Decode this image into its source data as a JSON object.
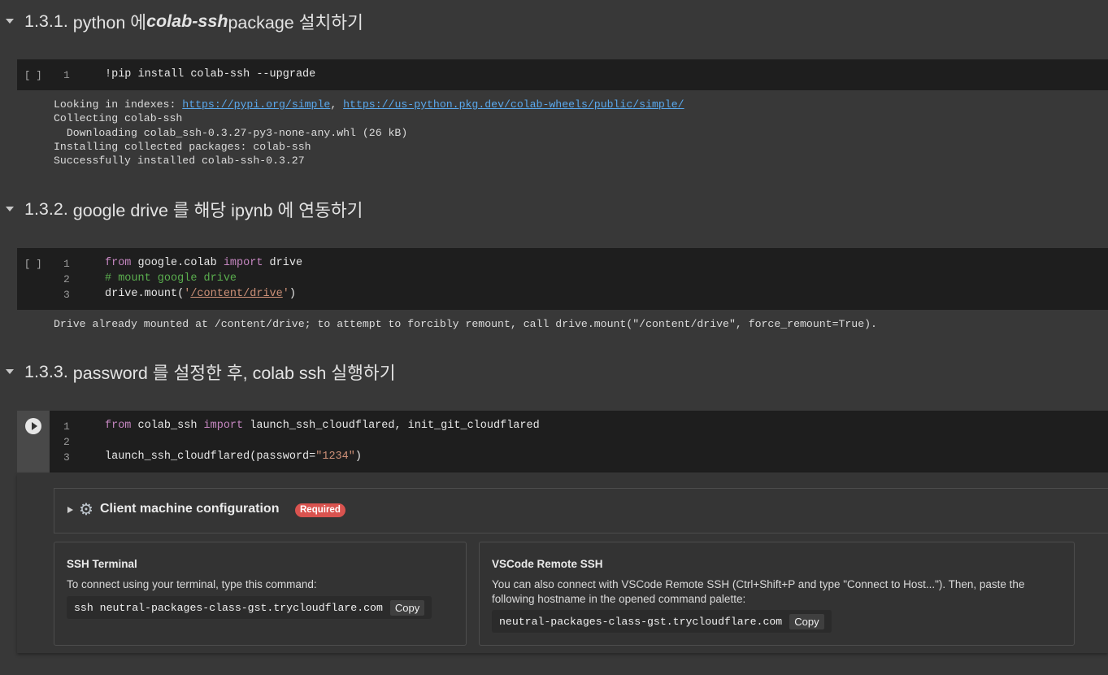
{
  "sections": [
    {
      "number": "1.3.1.",
      "pre": "python 에 ",
      "em": "colab-ssh",
      "post": " package 설치하기"
    },
    {
      "number": "1.3.2.",
      "pre": "google drive 를 해당 ipynb 에 연동하기",
      "em": "",
      "post": ""
    },
    {
      "number": "1.3.3.",
      "pre": "password 를 설정한 후, colab ssh 실행하기",
      "em": "",
      "post": ""
    }
  ],
  "cell1": {
    "exec": "[ ]",
    "line1_num": "1",
    "line1": "!pip install colab-ssh --upgrade",
    "output": {
      "l1_prefix": "Looking in indexes: ",
      "link1": "https://pypi.org/simple",
      "sep": ", ",
      "link2": "https://us-python.pkg.dev/colab-wheels/public/simple/",
      "l2": "Collecting colab-ssh",
      "l3": "  Downloading colab_ssh-0.3.27-py3-none-any.whl (26 kB)",
      "l4": "Installing collected packages: colab-ssh",
      "l5": "Successfully installed colab-ssh-0.3.27"
    }
  },
  "cell2": {
    "exec": "[ ]",
    "nums": [
      "1",
      "2",
      "3"
    ],
    "l1_kw1": "from",
    "l1_mod": " google.colab ",
    "l1_kw2": "import",
    "l1_name": " drive",
    "l2_comment": "# mount google drive",
    "l3_pre": "drive.mount(",
    "l3_q1": "'",
    "l3_path": "/content/drive",
    "l3_q2": "'",
    "l3_post": ")",
    "output": "Drive already mounted at /content/drive; to attempt to forcibly remount, call drive.mount(\"/content/drive\", force_remount=True)."
  },
  "cell3": {
    "nums": [
      "1",
      "2",
      "3"
    ],
    "l1_kw1": "from",
    "l1_mod": " colab_ssh ",
    "l1_kw2": "import",
    "l1_names": " launch_ssh_cloudflared, init_git_cloudflared",
    "l3_pre": "launch_ssh_cloudflared(password=",
    "l3_str": "\"1234\"",
    "l3_post": ")"
  },
  "config": {
    "title": "Client machine configuration",
    "badge": "Required",
    "icon": "gear-icon"
  },
  "ssh_terminal": {
    "title": "SSH Terminal",
    "desc": "To connect using your terminal, type this command:",
    "command": "ssh neutral-packages-class-gst.trycloudflare.com",
    "copy": "Copy"
  },
  "vscode": {
    "title": "VSCode Remote SSH",
    "desc_line1": "You can also connect with VSCode Remote SSH (Ctrl+Shift+P and type \"Connect to Host...\"). Then, paste the",
    "desc_line2": "following hostname in the opened command palette:",
    "hostname": "neutral-packages-class-gst.trycloudflare.com",
    "copy": "Copy"
  },
  "colors": {
    "background": "#383838",
    "cell_background": "#1e1e1e",
    "keyword": "#c586c0",
    "comment": "#5aad4e",
    "string": "#ce9178",
    "link": "#5aa9ee",
    "badge": "#d9534f"
  }
}
